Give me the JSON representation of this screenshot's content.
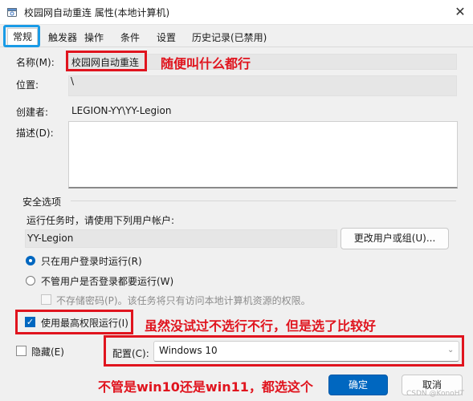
{
  "window": {
    "title": "校园网自动重连 属性(本地计算机)",
    "close_icon": "close-icon"
  },
  "tabs": [
    {
      "label": "常规",
      "active": true
    },
    {
      "label": "触发器"
    },
    {
      "label": "操作"
    },
    {
      "label": "条件"
    },
    {
      "label": "设置"
    },
    {
      "label": "历史记录(已禁用)"
    }
  ],
  "general": {
    "name_label": "名称(M):",
    "name_value": "校园网自动重连",
    "name_note": "随便叫什么都行",
    "location_label": "位置:",
    "location_value": "\\",
    "author_label": "创建者:",
    "author_value": "LEGION-YY\\YY-Legion",
    "description_label": "描述(D):",
    "description_value": ""
  },
  "security": {
    "group_label": "安全选项",
    "run_as_label": "运行任务时，请使用下列用户帐户:",
    "run_as_value": "YY-Legion",
    "change_user_button": "更改用户或组(U)...",
    "radio_logged_on": "只在用户登录时运行(R)",
    "radio_whether": "不管用户是否登录都要运行(W)",
    "no_store_password": "不存储密码(P)。该任务将只有访问本地计算机资源的权限。",
    "highest_privileges": "使用最高权限运行(I)",
    "highest_privileges_checked": true,
    "privileges_note": "虽然没试过不选行不行，但是选了比较好"
  },
  "footer": {
    "hidden_label": "隐藏(E)",
    "configure_label": "配置(C):",
    "configure_value": "Windows 10",
    "configure_note": "不管是win10还是win11，都选这个",
    "ok_button": "确定",
    "cancel_button": "取消",
    "watermark": "CSDN @KonoHT"
  },
  "colors": {
    "accent": "#0067c0",
    "annotation": "#e0141e",
    "tab_highlight": "#1a9be6"
  }
}
